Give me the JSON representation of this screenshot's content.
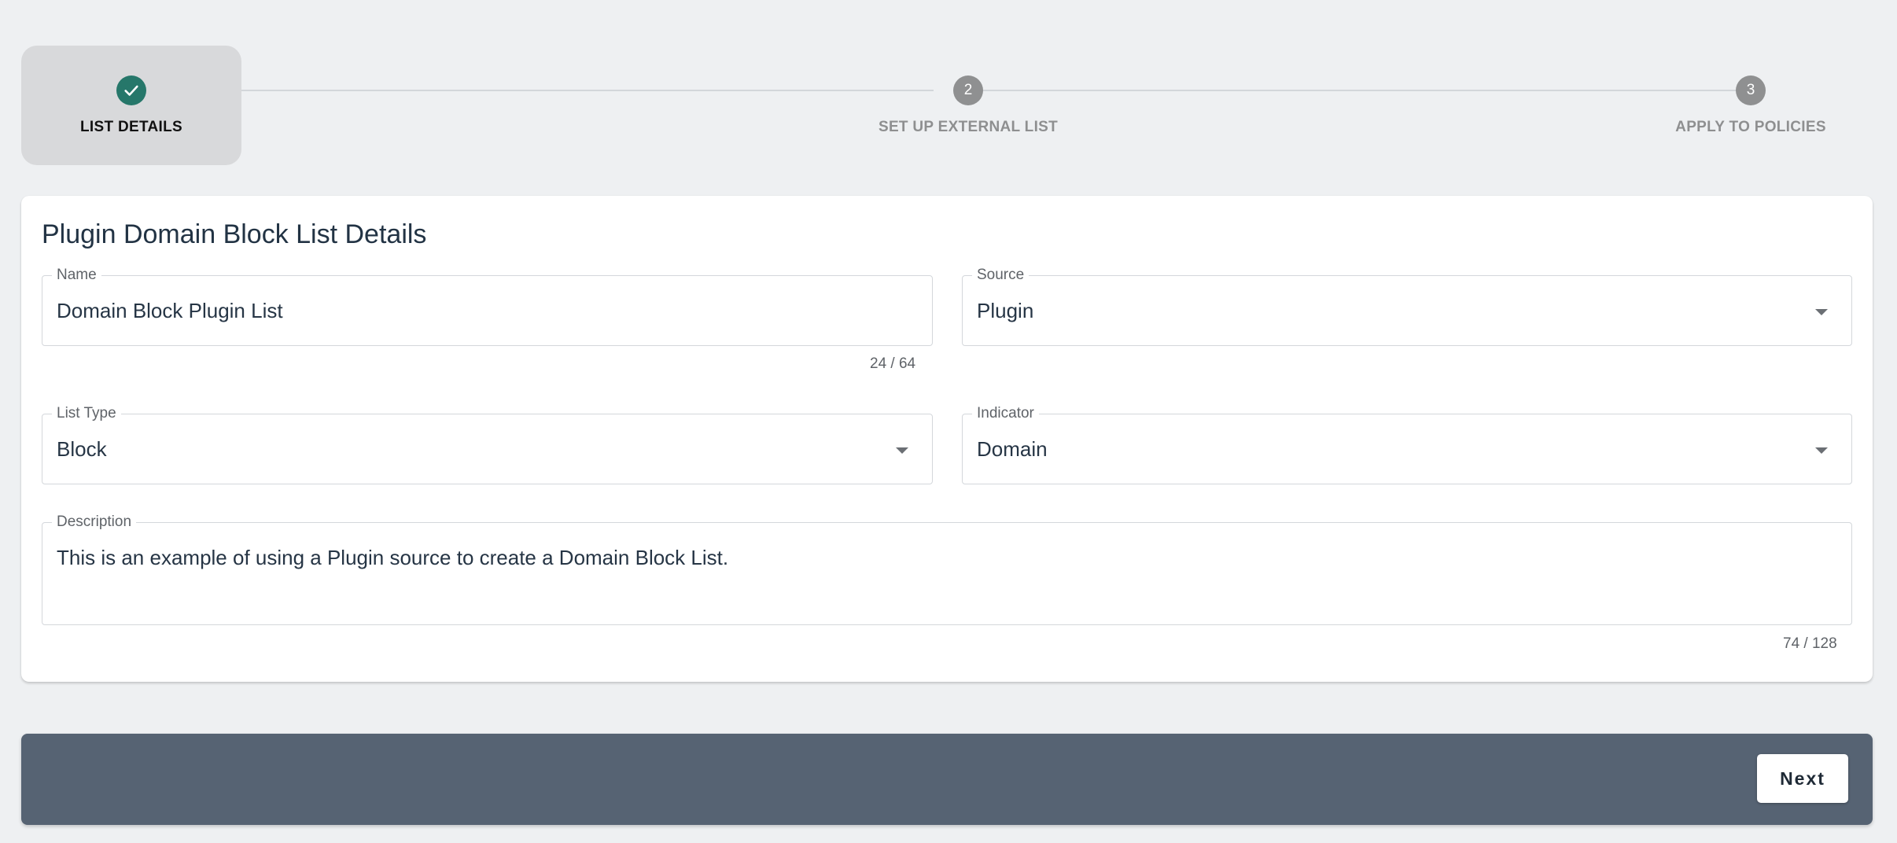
{
  "stepper": {
    "steps": [
      {
        "label": "LIST DETAILS",
        "number": "1",
        "status": "completed",
        "icon": "check-icon"
      },
      {
        "label": "SET UP EXTERNAL LIST",
        "number": "2",
        "status": "pending"
      },
      {
        "label": "APPLY TO POLICIES",
        "number": "3",
        "status": "pending"
      }
    ]
  },
  "form": {
    "title": "Plugin Domain Block List Details",
    "name": {
      "label": "Name",
      "value": "Domain Block Plugin List",
      "counter": "24 / 64"
    },
    "source": {
      "label": "Source",
      "value": "Plugin"
    },
    "list_type": {
      "label": "List Type",
      "value": "Block"
    },
    "indicator": {
      "label": "Indicator",
      "value": "Domain"
    },
    "description": {
      "label": "Description",
      "value": "This is an example of using a Plugin source to create a Domain Block List.",
      "counter": "74 / 128"
    }
  },
  "footer": {
    "next_label": "Next"
  },
  "colors": {
    "accent": "#26776a",
    "footer_bg": "#566373",
    "page_bg": "#eef0f2"
  }
}
